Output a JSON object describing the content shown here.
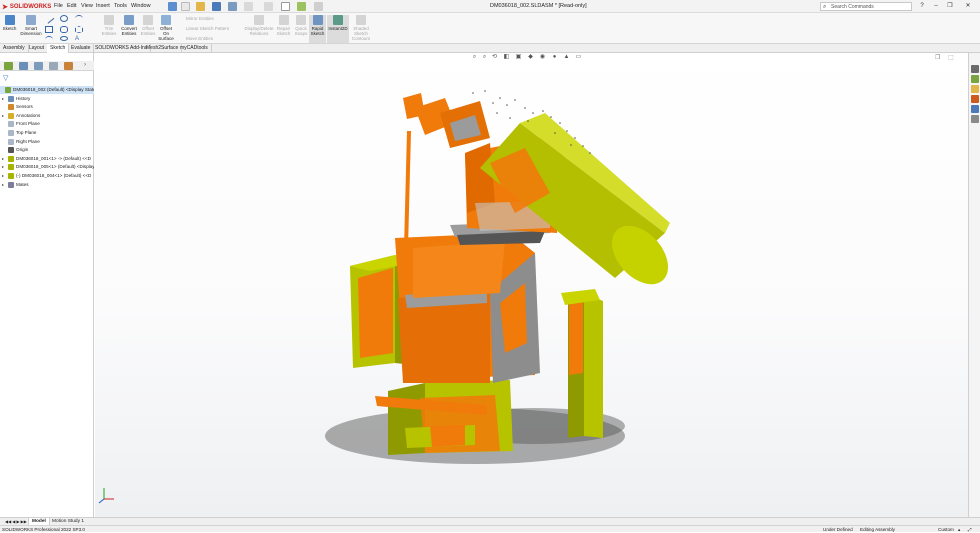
{
  "app": {
    "name": "SOLIDWORKS",
    "brand_color": "#d02020"
  },
  "menu": [
    "File",
    "Edit",
    "View",
    "Insert",
    "Tools",
    "Window"
  ],
  "document_title": "DM036018_002.SLDASM * [Read-only]",
  "search": {
    "placeholder": "Search Commands"
  },
  "window_buttons": {
    "minimize": "–",
    "restore": "❐",
    "close": "✕",
    "help": "?"
  },
  "ribbon": {
    "sketch": "Sketch",
    "smart_dimension": "Smart\nDimension",
    "trim": "Trim\nEntities",
    "convert": "Convert\nEntities",
    "offset": "Offset\nEntities",
    "offset_surface": "Offset\nOn\nSurface",
    "mirror": "Mirror Entities",
    "linear_pattern": "Linear Sketch Pattern",
    "move": "Move Entities",
    "display_delete": "Display/Delete\nRelations",
    "repair": "Repair\nSketch",
    "quick_snaps": "Quick\nSnaps",
    "rapid_sketch": "Rapid\nSketch",
    "instant2d": "Instant2D",
    "shaded_contours": "Shaded\nSketch\nContours"
  },
  "tabs": [
    "Assembly",
    "Layout",
    "Sketch",
    "Evaluate",
    "SOLIDWORKS Add-Ins",
    "Mesh2Surface",
    "myCADtools"
  ],
  "active_tab": "Sketch",
  "tree": [
    {
      "label": "DM036018_002 (Default) <Display State-1>",
      "level": 0,
      "icon": "assembly-icon",
      "selected": true
    },
    {
      "label": "History",
      "level": 1,
      "icon": "history-icon",
      "arrow": true
    },
    {
      "label": "Sensors",
      "level": 1,
      "icon": "sensor-icon"
    },
    {
      "label": "Annotations",
      "level": 1,
      "icon": "annotation-icon",
      "arrow": true
    },
    {
      "label": "Front Plane",
      "level": 1,
      "icon": "plane-icon"
    },
    {
      "label": "Top Plane",
      "level": 1,
      "icon": "plane-icon"
    },
    {
      "label": "Right Plane",
      "level": 1,
      "icon": "plane-icon"
    },
    {
      "label": "Origin",
      "level": 1,
      "icon": "origin-icon"
    },
    {
      "label": "DM036018_001<1> -> (Default) <<D",
      "level": 1,
      "icon": "part-icon",
      "arrow": true
    },
    {
      "label": "DM036018_005<1> (Default) <Display",
      "level": 1,
      "icon": "part-icon",
      "arrow": true
    },
    {
      "label": "(-) DM036018_004<1> (Default) <<D",
      "level": 1,
      "icon": "part-icon",
      "arrow": true
    },
    {
      "label": "Mates",
      "level": 1,
      "icon": "mates-icon",
      "arrow": true
    }
  ],
  "bottom_tabs": [
    "Model",
    "Motion Study 1"
  ],
  "active_bottom_tab": "Model",
  "status": {
    "left": "SOLIDWORKS Professional 2022 SP3.0",
    "under_defined": "Under Defined",
    "editing": "Editing Assembly",
    "units": "Custom"
  },
  "colors": {
    "part_yellow": "#b7c400",
    "part_orange": "#f07a0a",
    "part_gray": "#8d8d8d",
    "accent_blue": "#2a6ec0"
  }
}
